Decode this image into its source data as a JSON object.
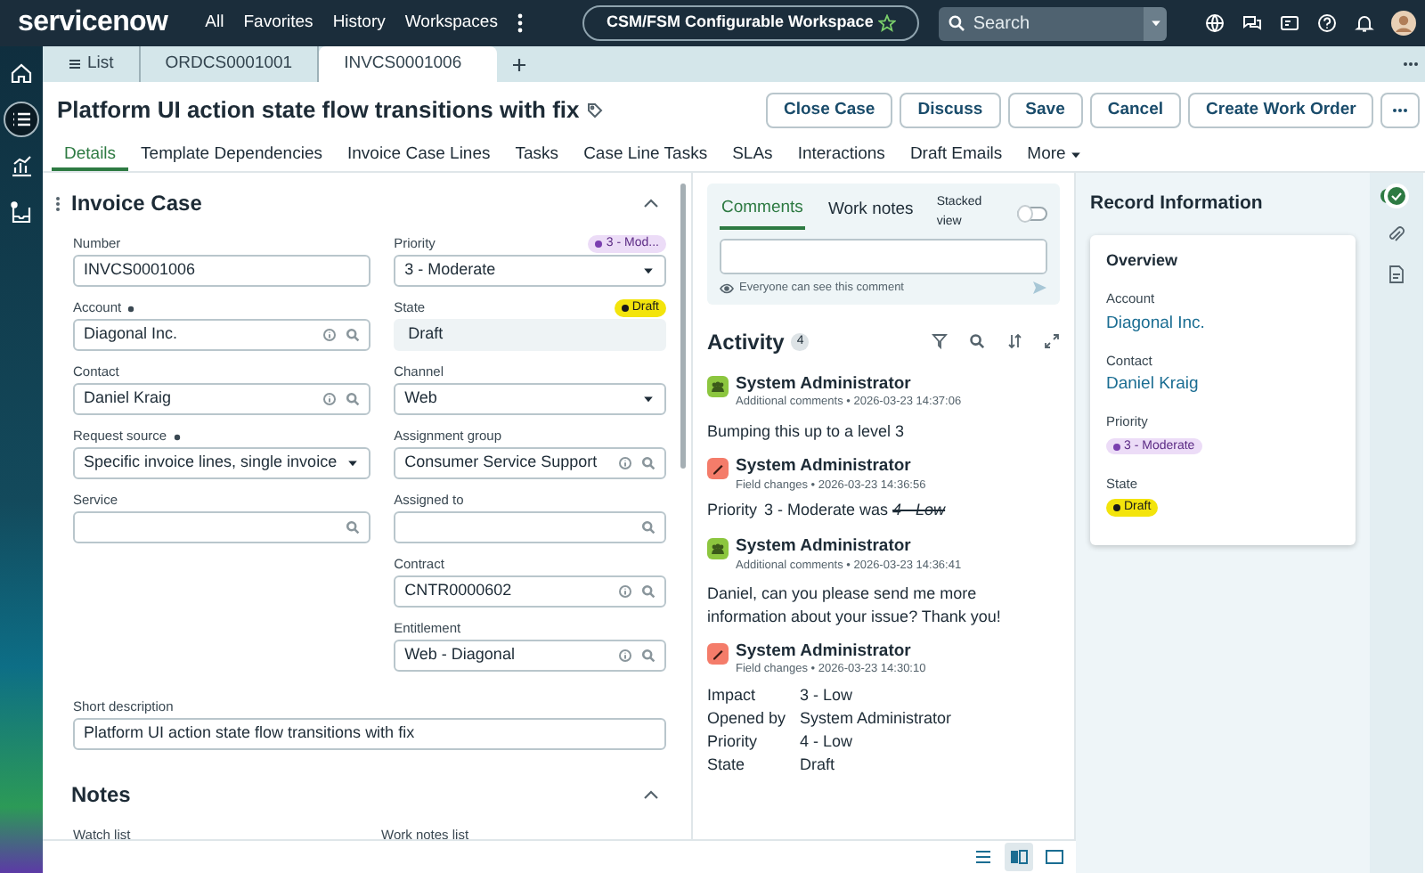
{
  "top_nav": {
    "logo": "servicenow",
    "menu": [
      "All",
      "Favorites",
      "History",
      "Workspaces"
    ],
    "workspace": "CSM/FSM Configurable Workspace",
    "search": {
      "placeholder": "Search"
    }
  },
  "tabs": [
    {
      "label": "List",
      "kind": "list",
      "selected": false
    },
    {
      "label": "ORDCS0001001",
      "kind": "record",
      "selected": false
    },
    {
      "label": "INVCS0001006",
      "kind": "record",
      "selected": true
    }
  ],
  "left_rail": [
    {
      "kind": "home",
      "selected": false
    },
    {
      "kind": "list",
      "selected": true
    },
    {
      "kind": "chart",
      "selected": false
    },
    {
      "kind": "inbox",
      "selected": false
    }
  ],
  "record": {
    "title": "Platform UI action state flow transitions with fix",
    "buttons": [
      "Close Case",
      "Discuss",
      "Save",
      "Cancel",
      "Create Work Order"
    ]
  },
  "sub_tabs": [
    {
      "label": "Details",
      "selected": true
    },
    {
      "label": "Template Dependencies",
      "selected": false
    },
    {
      "label": "Invoice Case Lines",
      "selected": false
    },
    {
      "label": "Tasks",
      "selected": false
    },
    {
      "label": "Case Line Tasks",
      "selected": false
    },
    {
      "label": "SLAs",
      "selected": false
    },
    {
      "label": "Interactions",
      "selected": false
    },
    {
      "label": "Draft Emails",
      "selected": false
    },
    {
      "label": "More",
      "selected": false
    }
  ],
  "form": {
    "title": "Invoice Case",
    "rows": [
      {
        "left": {
          "label": "Number",
          "value": "INVCS0001006",
          "kind": "text"
        },
        "right": {
          "label": "Priority",
          "value": "3 - Moderate",
          "kind": "select",
          "badge": {
            "text": "3 - Mod...",
            "color": "#7b3fb0"
          }
        }
      },
      {
        "left": {
          "label": "Account",
          "value": "Diagonal Inc.",
          "kind": "lookup",
          "required": true
        },
        "right": {
          "label": "State",
          "value": "Draft",
          "kind": "readonly",
          "badge": {
            "text": "Draft",
            "color": "#1a1a1a"
          }
        }
      },
      {
        "left": {
          "label": "Contact",
          "value": "Daniel Kraig",
          "kind": "lookup"
        },
        "right": {
          "label": "Channel",
          "value": "Web",
          "kind": "select"
        }
      },
      {
        "left": {
          "label": "Request source",
          "value": "Specific invoice lines, single invoice",
          "kind": "select",
          "required": true
        },
        "right": {
          "label": "Assignment group",
          "value": "Consumer Service Support",
          "kind": "lookup"
        }
      },
      {
        "left": {
          "label": "Service",
          "kind": "search"
        },
        "right": {
          "label": "Assigned to",
          "kind": "search"
        }
      },
      {
        "right": {
          "label": "Contract",
          "value": "CNTR0000602",
          "kind": "lookup"
        }
      },
      {
        "right": {
          "label": "Entitlement",
          "value": "Web - Diagonal",
          "kind": "lookup"
        }
      },
      {
        "full": {
          "label": "Short description",
          "value": "Platform UI action state flow transitions with fix",
          "kind": "text"
        }
      }
    ],
    "notes": {
      "title": "Notes",
      "labels": [
        "Watch list",
        "Work notes list"
      ]
    }
  },
  "comments": {
    "tabs": [
      {
        "label": "Comments",
        "selected": true
      },
      {
        "label": "Work notes",
        "selected": false
      }
    ],
    "stacked_view": {
      "label": "Stacked view",
      "on": false
    },
    "hint": "Everyone can see this comment"
  },
  "activity": {
    "title": "Activity",
    "count": "4",
    "entries": [
      {
        "kind": "comment",
        "author": "System Administrator",
        "meta": "Additional comments • 2026-03-23 14:37:06",
        "text": "Bumping this up to a level 3"
      },
      {
        "kind": "change",
        "author": "System Administrator",
        "meta": "Field changes • 2026-03-23 14:36:56",
        "changes": [
          {
            "field": "Priority",
            "value": "3 - Moderate",
            "was": "was",
            "old": "4 - Low"
          }
        ]
      },
      {
        "kind": "comment",
        "author": "System Administrator",
        "meta": "Additional comments • 2026-03-23 14:36:41",
        "text": "Daniel, can you please send me more information about your issue? Thank you!"
      },
      {
        "kind": "change",
        "author": "System Administrator",
        "meta": "Field changes • 2026-03-23 14:30:10",
        "changes": [
          {
            "field": "Impact",
            "value": "3 - Low"
          },
          {
            "field": "Opened by",
            "value": "System Administrator"
          },
          {
            "field": "Priority",
            "value": "4 - Low"
          },
          {
            "field": "State",
            "value": "Draft"
          }
        ]
      }
    ]
  },
  "record_info": {
    "title": "Record Information",
    "card_title": "Overview",
    "items": [
      {
        "label": "Account",
        "value": "Diagonal Inc.",
        "kind": "link"
      },
      {
        "label": "Contact",
        "value": "Daniel Kraig",
        "kind": "link"
      },
      {
        "label": "Priority",
        "value": "3 - Moderate",
        "kind": "badge",
        "color": "#7b3fb0"
      },
      {
        "label": "State",
        "value": "Draft",
        "kind": "badge",
        "color": "#1a1a1a"
      }
    ]
  },
  "right_rail": [
    {
      "kind": "check",
      "selected": true
    },
    {
      "kind": "attachment",
      "selected": false
    },
    {
      "kind": "document",
      "selected": false
    }
  ],
  "view_modes": [
    {
      "kind": "list",
      "selected": false
    },
    {
      "kind": "split",
      "selected": true
    },
    {
      "kind": "single",
      "selected": false
    }
  ]
}
